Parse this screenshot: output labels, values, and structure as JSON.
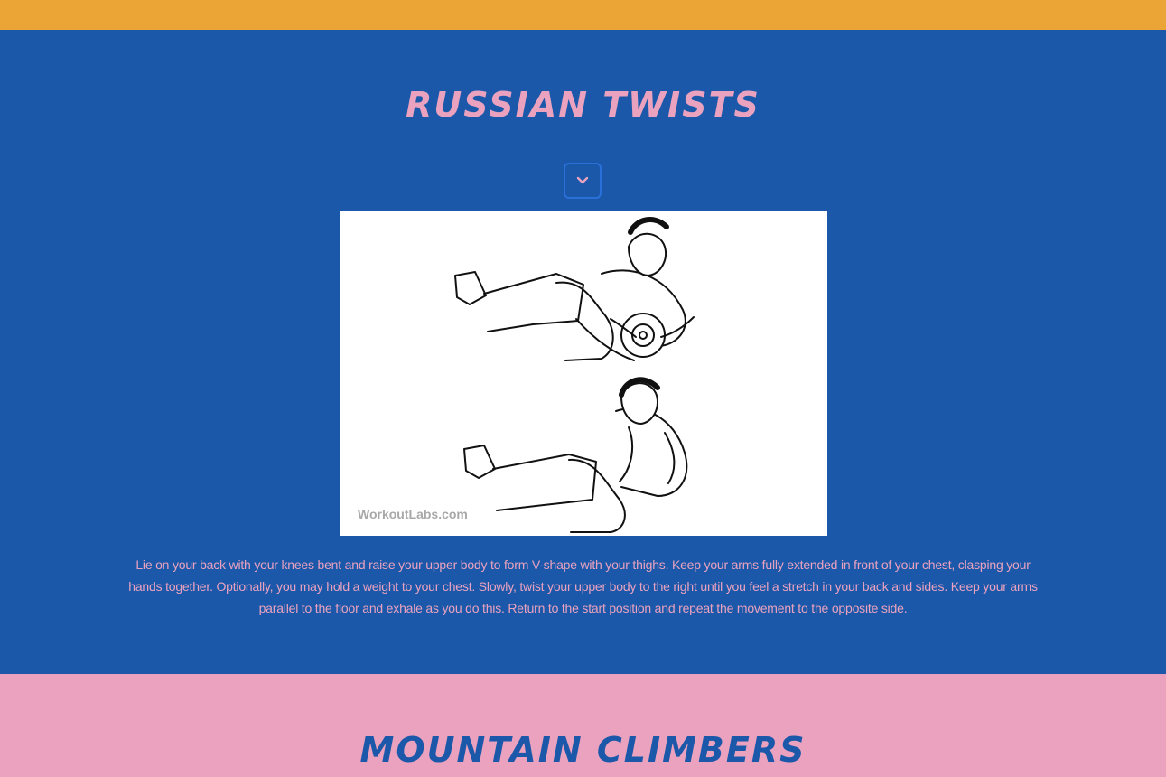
{
  "exercises": [
    {
      "title": "RUSSIAN TWISTS",
      "image_watermark": "WorkoutLabs.com",
      "description": "Lie on your back with your knees bent and raise your upper body to form V-shape with your thighs. Keep your arms fully extended in front of your chest, clasping your hands together. Optionally, you may hold a weight to your chest. Slowly, twist your upper body to the right until you feel a stretch in your back and sides. Keep your arms parallel to the floor and exhale as you do this. Return to the start position and repeat the movement to the opposite side."
    },
    {
      "title": "MOUNTAIN CLIMBERS"
    }
  ],
  "icons": {
    "expand": "chevron-down-icon"
  },
  "colors": {
    "top_band": "#EBA536",
    "blue_section": "#1B58A9",
    "pink": "#EAA2BF",
    "button_border": "#2970D8"
  }
}
